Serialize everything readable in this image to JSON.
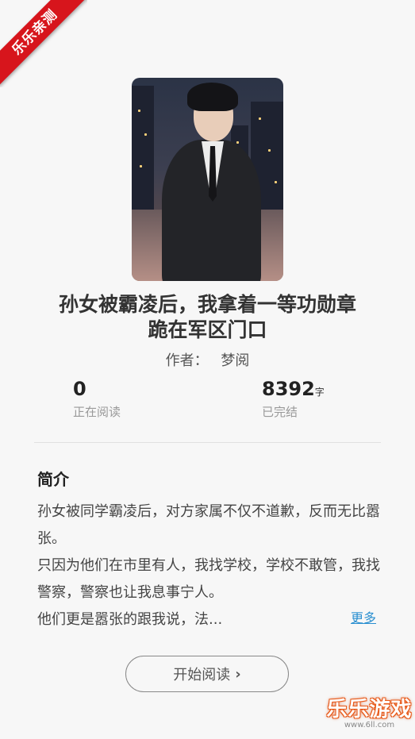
{
  "badge": {
    "text": "乐乐亲测",
    "color": "#d7151c"
  },
  "book": {
    "title_line1": "孙女被霸凌后，我拿着一等功勋章",
    "title_line2": "跪在军区门口",
    "author_label": "作者：",
    "author_name": "梦阅"
  },
  "stats": {
    "readers_value": "0",
    "readers_label": "正在阅读",
    "words_value": "8392",
    "words_unit": "字",
    "status_label": "已完结"
  },
  "intro": {
    "heading": "简介",
    "paragraphs": [
      "孙女被同学霸凌后，对方家属不仅不道歉，反而无比嚣张。",
      "只因为他们在市里有人，我找学校，学校不敢管，我找警察，警察也让我息事宁人。",
      "他们更是嚣张的跟我说，法..."
    ],
    "more_label": "更多"
  },
  "actions": {
    "read_label": "开始阅读"
  },
  "watermark": {
    "brand": "乐乐游戏",
    "url": "www.6ll.com"
  },
  "icons": {
    "chevron": "chevron-right-icon"
  }
}
